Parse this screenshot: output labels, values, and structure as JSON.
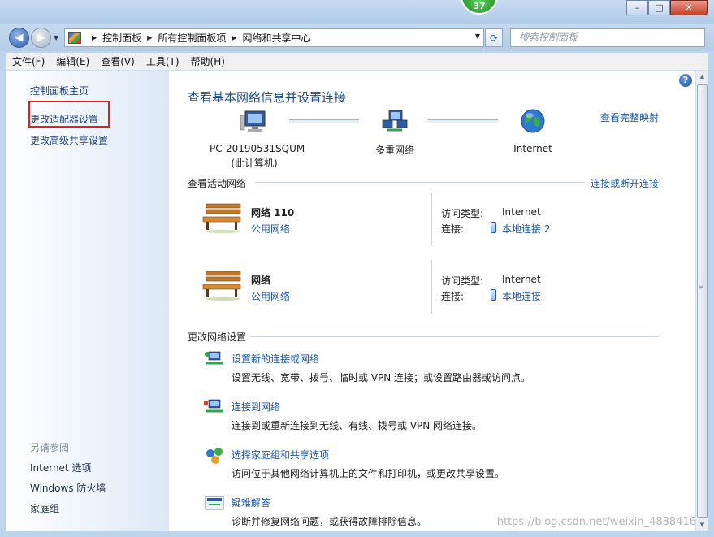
{
  "window": {
    "badge": "37",
    "minimize": "–",
    "maximize": "□",
    "close": "✕"
  },
  "nav": {
    "back": "◀",
    "forward": "▶",
    "breadcrumb": [
      "控制面板",
      "所有控制面板项",
      "网络和共享中心"
    ],
    "search_placeholder": "搜索控制面板"
  },
  "menu": [
    "文件(F)",
    "编辑(E)",
    "查看(V)",
    "工具(T)",
    "帮助(H)"
  ],
  "sidebar": {
    "items": [
      "控制面板主页",
      "更改适配器设置",
      "更改高级共享设置"
    ],
    "see_also_heading": "另请参阅",
    "see_also": [
      "Internet 选项",
      "Windows 防火墙",
      "家庭组"
    ]
  },
  "main": {
    "title": "查看基本网络信息并设置连接",
    "full_map_link": "查看完整映射",
    "map": {
      "computer_name": "PC-20190531SQUM",
      "computer_sub": "(此计算机)",
      "middle": "多重网络",
      "internet": "Internet"
    },
    "active_heading": "查看活动网络",
    "connect_link": "连接或断开连接",
    "networks": [
      {
        "name": "网络  110",
        "type": "公用网络",
        "access_key": "访问类型:",
        "access_val": "Internet",
        "conn_key": "连接:",
        "conn_val": "本地连接 2"
      },
      {
        "name": "网络",
        "type": "公用网络",
        "access_key": "访问类型:",
        "access_val": "Internet",
        "conn_key": "连接:",
        "conn_val": "本地连接"
      }
    ],
    "change_heading": "更改网络设置",
    "tasks": [
      {
        "title": "设置新的连接或网络",
        "desc": "设置无线、宽带、拨号、临时或 VPN 连接；或设置路由器或访问点。"
      },
      {
        "title": "连接到网络",
        "desc": "连接到或重新连接到无线、有线、拨号或 VPN 网络连接。"
      },
      {
        "title": "选择家庭组和共享选项",
        "desc": "访问位于其他网络计算机上的文件和打印机，或更改共享设置。"
      },
      {
        "title": "疑难解答",
        "desc": "诊断并修复网络问题，或获得故障排除信息。"
      }
    ]
  },
  "watermark": "https://blog.csdn.net/weixin_4838416"
}
